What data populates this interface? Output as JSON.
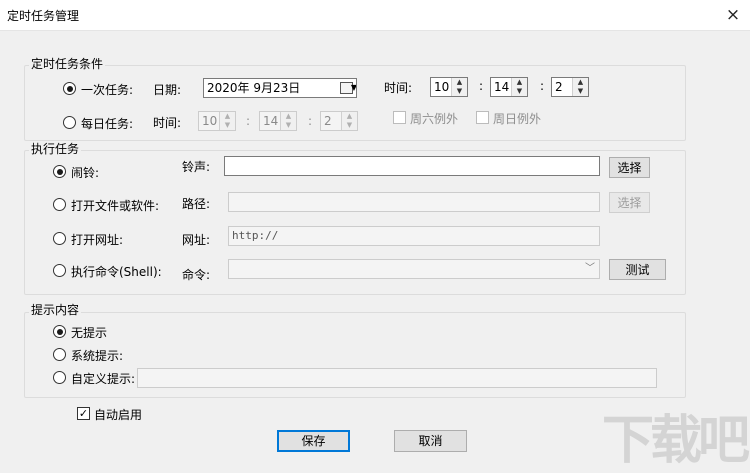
{
  "window": {
    "title": "定时任务管理",
    "close_glyph": "×"
  },
  "condition_group": {
    "legend": "定时任务条件",
    "once": {
      "label": "一次任务:",
      "date_label": "日期:",
      "date_value": "2020年 9月23日",
      "time_label": "时间:",
      "hour": "10",
      "minute": "14",
      "second": "2",
      "colon": ":"
    },
    "daily": {
      "label": "每日任务:",
      "time_label": "时间:",
      "hour": "10",
      "minute": "14",
      "second": "2",
      "saturday_label": "周六例外",
      "sunday_label": "周日例外"
    }
  },
  "execute_group": {
    "legend": "执行任务",
    "alarm": {
      "label": "闹铃:",
      "field_label": "铃声:",
      "value": "",
      "button": "选择"
    },
    "open_file": {
      "label": "打开文件或软件:",
      "field_label": "路径:",
      "value": "",
      "button": "选择"
    },
    "open_url": {
      "label": "打开网址:",
      "field_label": "网址:",
      "value": "http://"
    },
    "shell": {
      "label": "执行命令(Shell):",
      "field_label": "命令:",
      "value": "",
      "button": "测试"
    }
  },
  "prompt_group": {
    "legend": "提示内容",
    "none": "无提示",
    "system": "系统提示:",
    "custom": "自定义提示:",
    "custom_value": ""
  },
  "auto_enable": {
    "label": "自动启用",
    "checked": true,
    "mark": "✓"
  },
  "footer": {
    "save": "保存",
    "cancel": "取消"
  },
  "watermark": "下载吧"
}
